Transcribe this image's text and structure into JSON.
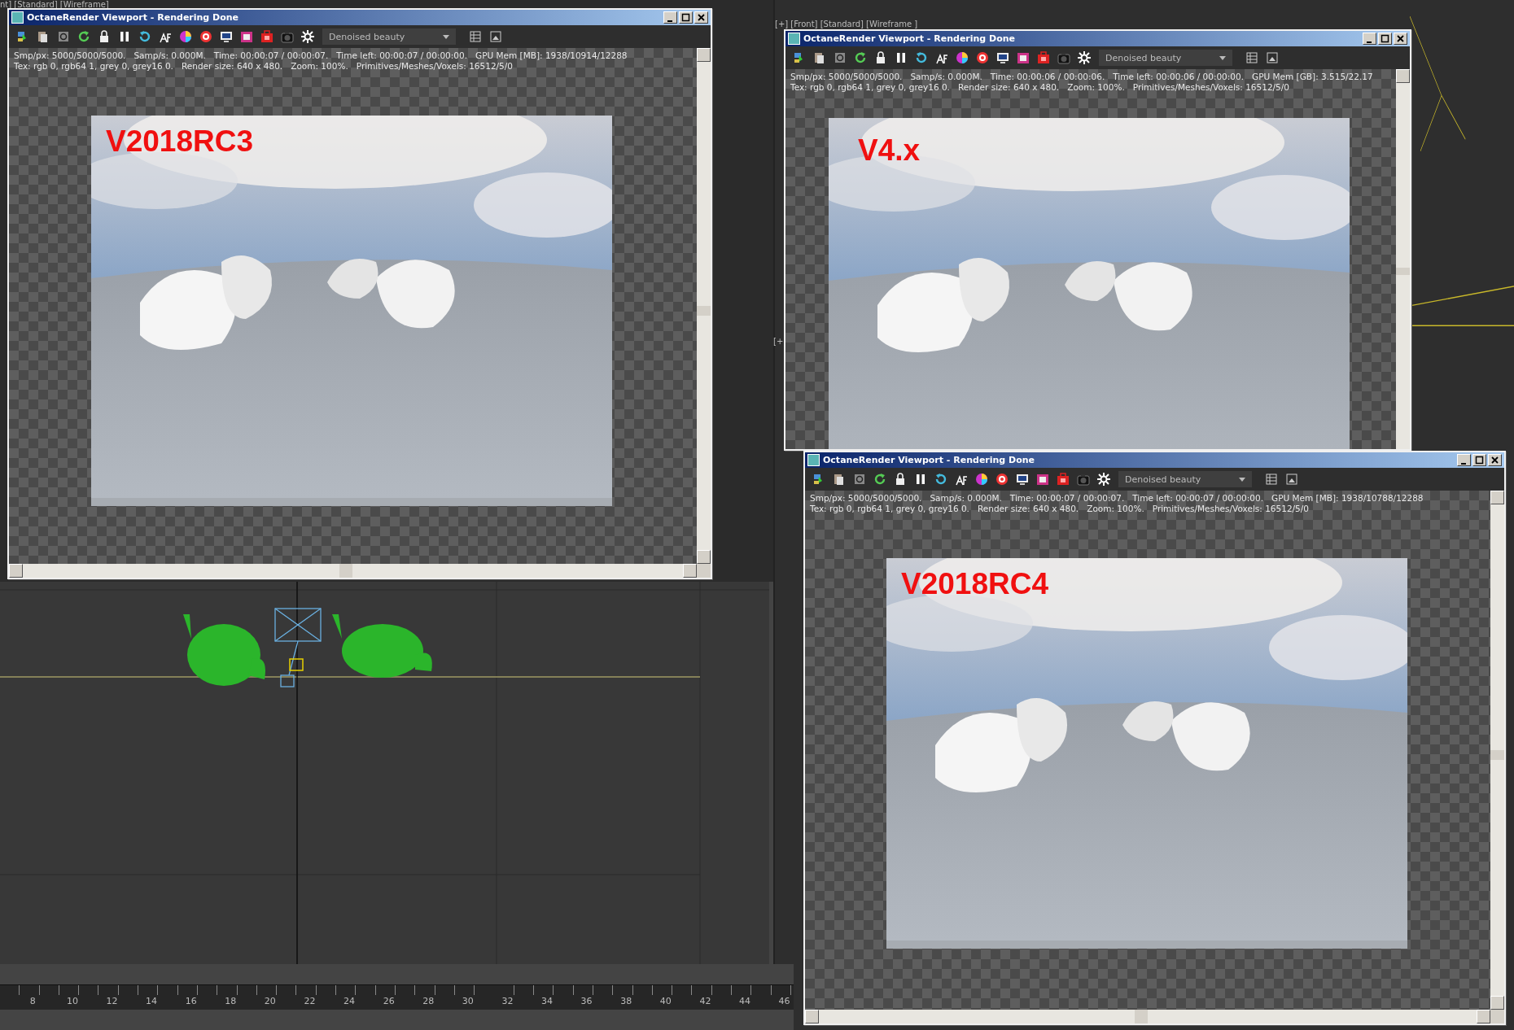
{
  "viewport_labels": [
    {
      "text": "nt] [Standard] [Wireframe]",
      "kind": "topleft"
    },
    {
      "text": "[+] [Front] [Standard] [Wireframe ]",
      "kind": "front"
    },
    {
      "text": "[+",
      "kind": "side"
    }
  ],
  "windows": [
    {
      "title": "OctaneRender Viewport - Rendering Done",
      "pass": "Denoised beauty",
      "info": [
        "Smp/px: 5000/5000/5000.   Samp/s: 0.000M.   Time: 00:00:07 / 00:00:07.   Time left: 00:00:07 / 00:00:00.   GPU Mem [MB]: 1938/10914/12288",
        "Tex: rgb 0, rgb64 1, grey 0, grey16 0.   Render size: 640 x 480.   Zoom: 100%.   Primitives/Meshes/Voxels: 16512/5/0"
      ],
      "render_label": "V2018RC3"
    },
    {
      "title": "OctaneRender Viewport - Rendering Done",
      "pass": "Denoised beauty",
      "info": [
        "Smp/px: 5000/5000/5000.   Samp/s: 0.000M.   Time: 00:00:06 / 00:00:06.   Time left: 00:00:06 / 00:00:00.   GPU Mem [GB]: 3.515/22.17",
        "Tex: rgb 0, rgb64 1, grey 0, grey16 0.   Render size: 640 x 480.   Zoom: 100%.   Primitives/Meshes/Voxels: 16512/5/0"
      ],
      "render_label": "V4.x"
    },
    {
      "title": "OctaneRender Viewport - Rendering Done",
      "pass": "Denoised beauty",
      "info": [
        "Smp/px: 5000/5000/5000.   Samp/s: 0.000M.   Time: 00:00:07 / 00:00:07.   Time left: 00:00:07 / 00:00:00.   GPU Mem [MB]: 1938/10788/12288",
        "Tex: rgb 0, rgb64 1, grey 0, grey16 0.   Render size: 640 x 480.   Zoom: 100%.   Primitives/Meshes/Voxels: 16512/5/0"
      ],
      "render_label": "V2018RC4"
    }
  ],
  "timeline": {
    "ticks": [
      "8",
      "10",
      "12",
      "14",
      "16",
      "18",
      "20",
      "22",
      "24",
      "26",
      "28",
      "30",
      "32",
      "34",
      "36",
      "38",
      "40",
      "42",
      "44",
      "46"
    ]
  }
}
